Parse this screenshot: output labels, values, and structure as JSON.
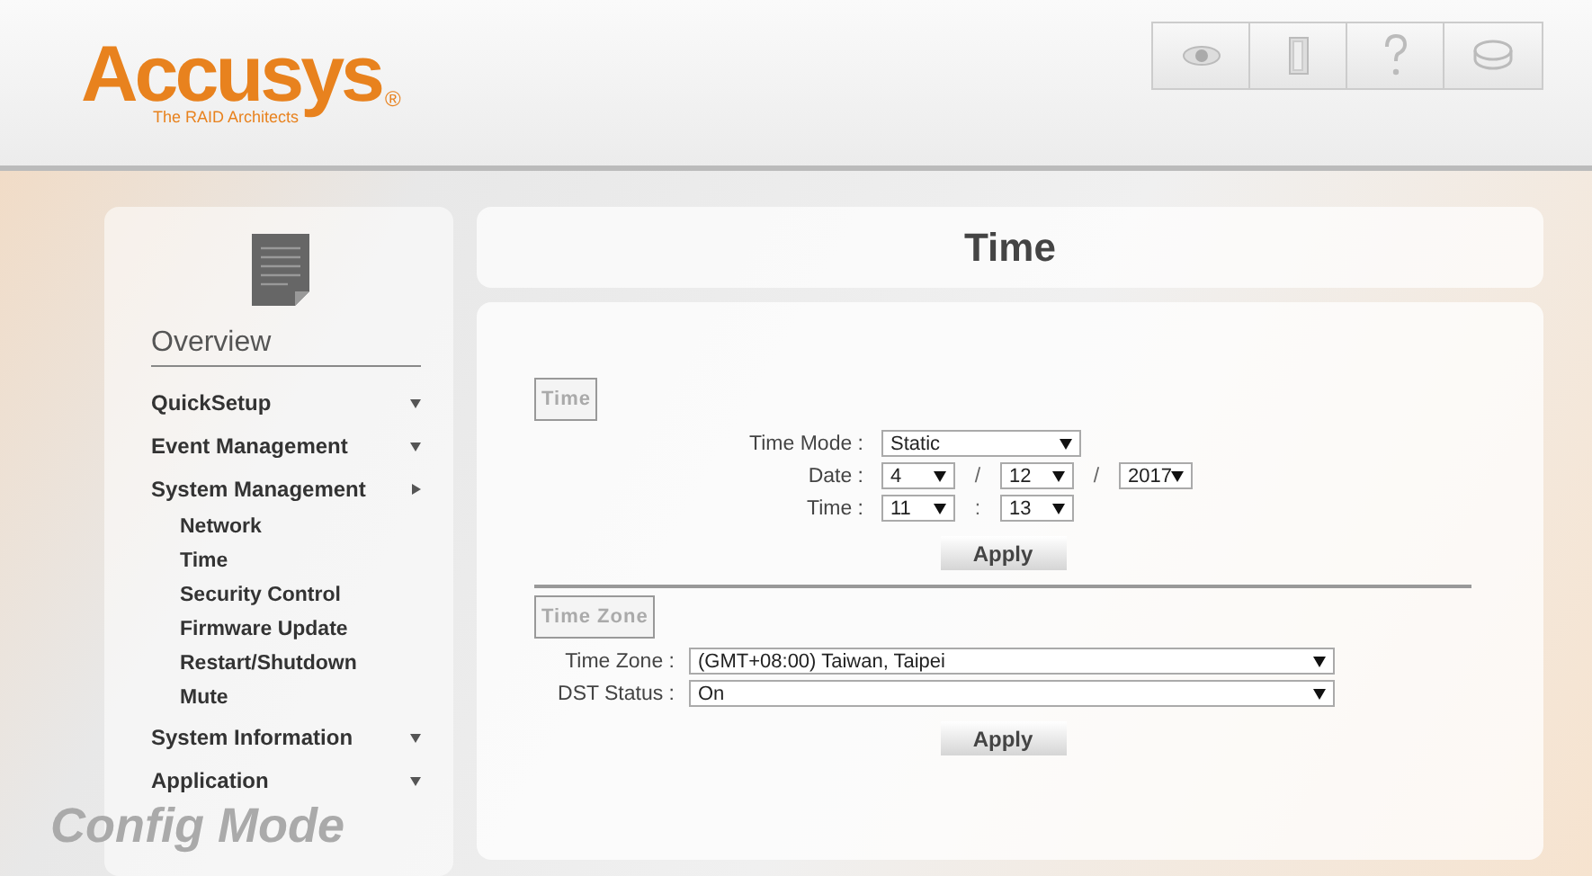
{
  "logo": {
    "name": "Accusys",
    "mark": "®",
    "tagline": "The RAID Architects"
  },
  "sidebar": {
    "title": "Overview",
    "items": [
      {
        "label": "QuickSetup",
        "expanded": false
      },
      {
        "label": "Event Management",
        "expanded": false
      },
      {
        "label": "System Management",
        "expanded": true,
        "children": [
          {
            "label": "Network"
          },
          {
            "label": "Time"
          },
          {
            "label": "Security Control"
          },
          {
            "label": "Firmware Update"
          },
          {
            "label": "Restart/Shutdown"
          },
          {
            "label": "Mute"
          }
        ]
      },
      {
        "label": "System Information",
        "expanded": false
      },
      {
        "label": "Application",
        "expanded": false
      }
    ],
    "mode": "Config Mode"
  },
  "page_title": "Time",
  "sections": [
    {
      "legend": "Time",
      "rows": [
        {
          "label": "Time Mode :",
          "fields": [
            {
              "value": "Static"
            }
          ]
        },
        {
          "label": "Date :",
          "fields": [
            {
              "value": "4"
            },
            {
              "sep": "/",
              "value": "12"
            },
            {
              "sep": "/",
              "value": "2017"
            }
          ]
        },
        {
          "label": "Time :",
          "fields": [
            {
              "value": "11"
            },
            {
              "sep": ":",
              "value": "13"
            }
          ]
        }
      ],
      "button": "Apply"
    },
    {
      "legend": "Time Zone",
      "rows": [
        {
          "label": "Time Zone :",
          "fields": [
            {
              "value": "(GMT+08:00) Taiwan, Taipei"
            }
          ]
        },
        {
          "label": "DST Status :",
          "fields": [
            {
              "value": "On"
            }
          ]
        }
      ],
      "button": "Apply"
    }
  ]
}
